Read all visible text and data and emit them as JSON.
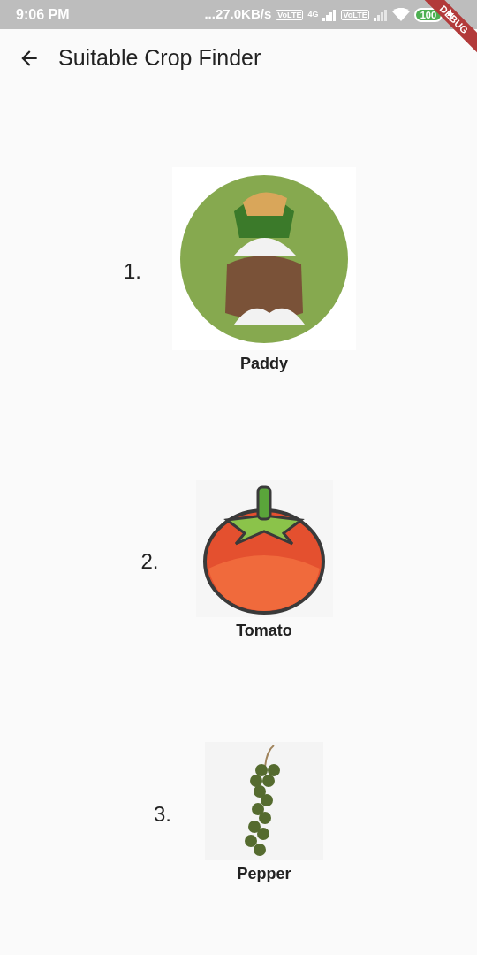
{
  "status_bar": {
    "time": "9:06 PM",
    "speed": "...27.0KB/s",
    "sim1_badge": "VoLTE",
    "network": "4G",
    "sim2_badge": "VoLTE",
    "battery": "100"
  },
  "debug_banner": "DEBUG",
  "app_bar": {
    "title": "Suitable Crop Finder"
  },
  "crops": [
    {
      "number": "1.",
      "name": "Paddy"
    },
    {
      "number": "2.",
      "name": "Tomato"
    },
    {
      "number": "3.",
      "name": "Pepper"
    }
  ]
}
